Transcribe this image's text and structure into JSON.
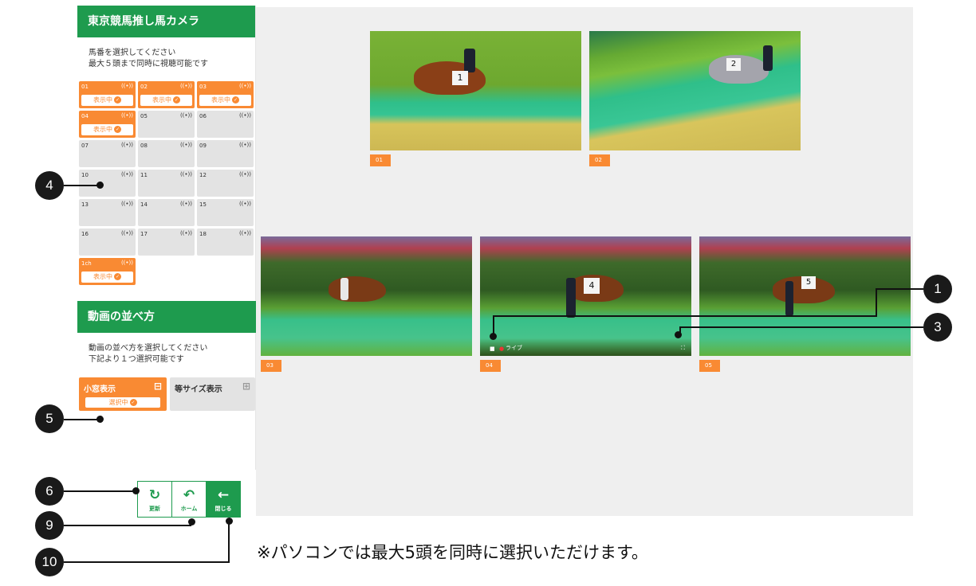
{
  "sidebar": {
    "camera": {
      "title": "東京競馬推し馬カメラ",
      "desc1": "馬番を選択してください",
      "desc2": "最大５頭まで同時に視聴可能です",
      "cells": [
        {
          "num": "01",
          "selected": true,
          "badge": "表示中"
        },
        {
          "num": "02",
          "selected": true,
          "badge": "表示中"
        },
        {
          "num": "03",
          "selected": true,
          "badge": "表示中"
        },
        {
          "num": "04",
          "selected": true,
          "badge": "表示中"
        },
        {
          "num": "05",
          "selected": false
        },
        {
          "num": "06",
          "selected": false
        },
        {
          "num": "07",
          "selected": false
        },
        {
          "num": "08",
          "selected": false
        },
        {
          "num": "09",
          "selected": false
        },
        {
          "num": "10",
          "selected": false
        },
        {
          "num": "11",
          "selected": false
        },
        {
          "num": "12",
          "selected": false
        },
        {
          "num": "13",
          "selected": false
        },
        {
          "num": "14",
          "selected": false
        },
        {
          "num": "15",
          "selected": false
        },
        {
          "num": "16",
          "selected": false
        },
        {
          "num": "17",
          "selected": false
        },
        {
          "num": "18",
          "selected": false
        },
        {
          "num": "1ch",
          "selected": true,
          "badge": "表示中"
        }
      ],
      "live_icon": "((•))"
    },
    "layout": {
      "title": "動画の並べ方",
      "desc1": "動画の並べ方を選択してください",
      "desc2": "下記より１つ選択可能です",
      "small_label": "小窓表示",
      "small_badge": "選択中",
      "equal_label": "等サイズ表示"
    },
    "buttons": {
      "refresh": "更新",
      "home": "ホーム",
      "close": "閉じる"
    }
  },
  "videos": {
    "tags": [
      "01",
      "02",
      "03",
      "04",
      "05"
    ],
    "live_label": "ライブ",
    "horse_numbers": [
      "1",
      "2",
      "4",
      "5"
    ]
  },
  "annotations": {
    "markers": [
      "1",
      "3",
      "4",
      "5",
      "6",
      "9",
      "10"
    ],
    "note": "※パソコンでは最大5頭を同時に選択いただけます。"
  },
  "colors": {
    "brand_green": "#1e9b4e",
    "accent_orange": "#f98a33",
    "stage_bg": "#efefef"
  }
}
